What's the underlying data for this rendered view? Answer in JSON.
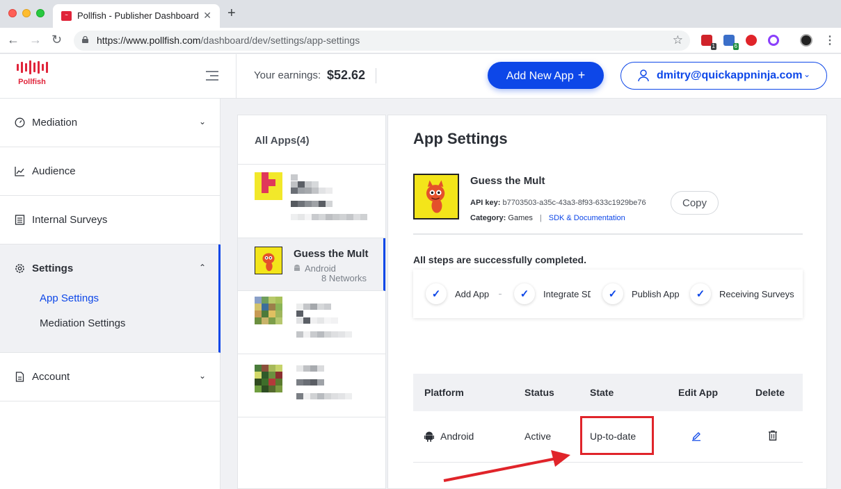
{
  "browser": {
    "tab_title": "Pollfish - Publisher Dashboard",
    "url_host": "https://www.pollfish.com",
    "url_path": "/dashboard/dev/settings/app-settings",
    "extensions": [
      {
        "icon": "ext-red-icon",
        "badge": "1",
        "color": "#d0232a",
        "badge_color": "#3c4043"
      },
      {
        "icon": "ext-code-icon",
        "badge": "6",
        "color": "#3b6fc9",
        "badge_color": "#1e8e3e"
      },
      {
        "icon": "ext-star-icon",
        "badge": "",
        "color": "#e0242a",
        "badge_color": ""
      },
      {
        "icon": "ext-octo-icon",
        "badge": "",
        "color": "#8a3ffc",
        "badge_color": ""
      }
    ]
  },
  "header": {
    "logo_text": "Pollfish",
    "earnings_label": "Your earnings:",
    "earnings_value": "$52.62",
    "add_app_label": "Add New App",
    "add_app_icon": "+",
    "user_email": "dmitry@quickappninja.com"
  },
  "sidebar": {
    "items": [
      {
        "label": "Mediation",
        "icon": "speedometer-icon"
      },
      {
        "label": "Audience",
        "icon": "line-chart-icon"
      },
      {
        "label": "Internal Surveys",
        "icon": "list-icon"
      },
      {
        "label": "Settings",
        "icon": "gear-icon"
      },
      {
        "label": "Account",
        "icon": "document-icon"
      }
    ],
    "settings_sub": [
      {
        "label": "App Settings"
      },
      {
        "label": "Mediation Settings"
      }
    ]
  },
  "apps": {
    "title": "All Apps(4)",
    "selected": {
      "name": "Guess the Mult",
      "platform": "Android",
      "networks": "8 Networks"
    }
  },
  "settings": {
    "title": "App Settings",
    "app_name": "Guess the Mult",
    "api_key_label": "API key:",
    "api_key": "b7703503-a35c-43a3-8f93-633c1929be76",
    "copy_label": "Copy",
    "category_label": "Category:",
    "category": "Games",
    "separator": "|",
    "sdk_link": "SDK & Documentation",
    "steps_title": "All steps are successfully completed.",
    "steps": [
      {
        "label": "Add App"
      },
      {
        "label": "Integrate SDK"
      },
      {
        "label": "Publish App"
      },
      {
        "label": "Receiving Surveys"
      }
    ],
    "table": {
      "headers": [
        "Platform",
        "Status",
        "State",
        "Edit App",
        "Delete"
      ],
      "row": {
        "platform": "Android",
        "status": "Active",
        "state": "Up-to-date"
      }
    }
  },
  "colors": {
    "accent": "#0d47e8",
    "brand": "#e0243a",
    "highlight": "#e0242a"
  }
}
